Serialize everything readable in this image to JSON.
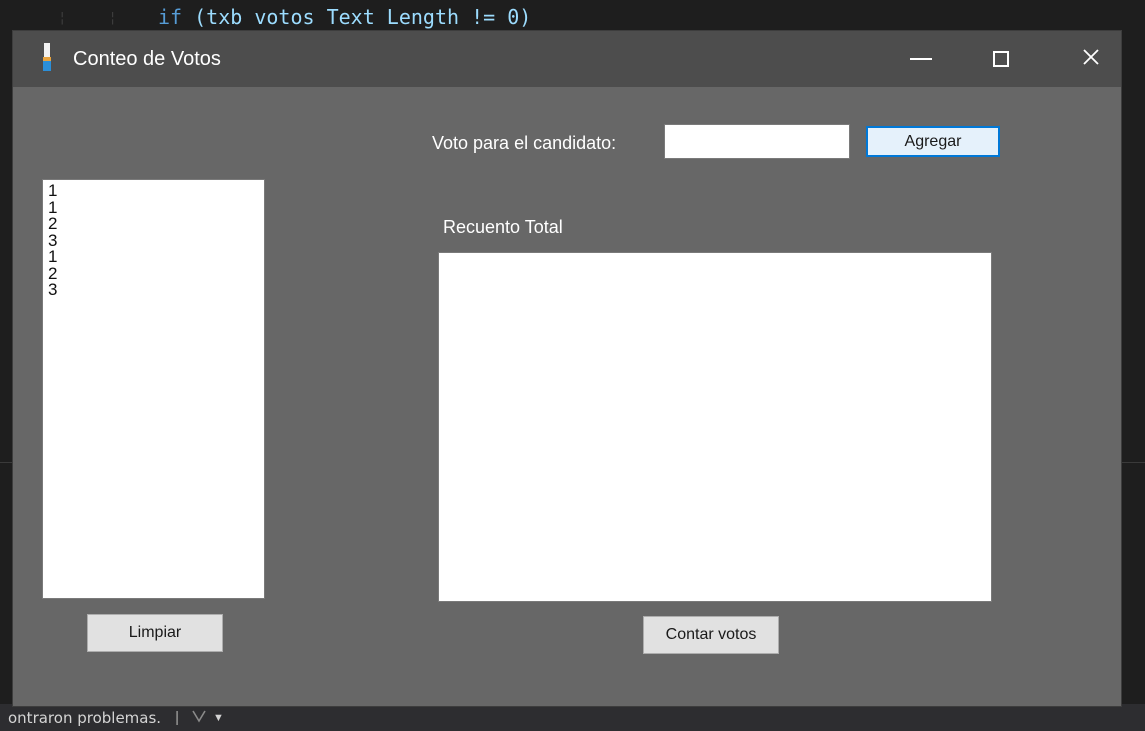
{
  "ide": {
    "code_keyword": "if",
    "code_rest": " (txb votos Text Length != 0)",
    "status_text": "ontraron problemas.",
    "status_separator": "|"
  },
  "window": {
    "title": "Conteo de Votos",
    "icon": "app-icon",
    "controls": {
      "minimize": "minimize-icon",
      "maximize": "maximize-icon",
      "close": "✕"
    }
  },
  "form": {
    "vote_label": "Voto para el candidato:",
    "vote_input_value": "",
    "add_button": "Agregar",
    "votes_list": [
      "1",
      "1",
      "2",
      "3",
      "1",
      "2",
      "3"
    ],
    "clear_button": "Limpiar",
    "total_label": "Recuento Total",
    "total_text": "",
    "count_button": "Contar votos"
  },
  "colors": {
    "window_bg": "#676767",
    "titlebar_bg": "#4d4d4d",
    "accent": "#0078d7",
    "button_bg": "#e1e1e1"
  }
}
